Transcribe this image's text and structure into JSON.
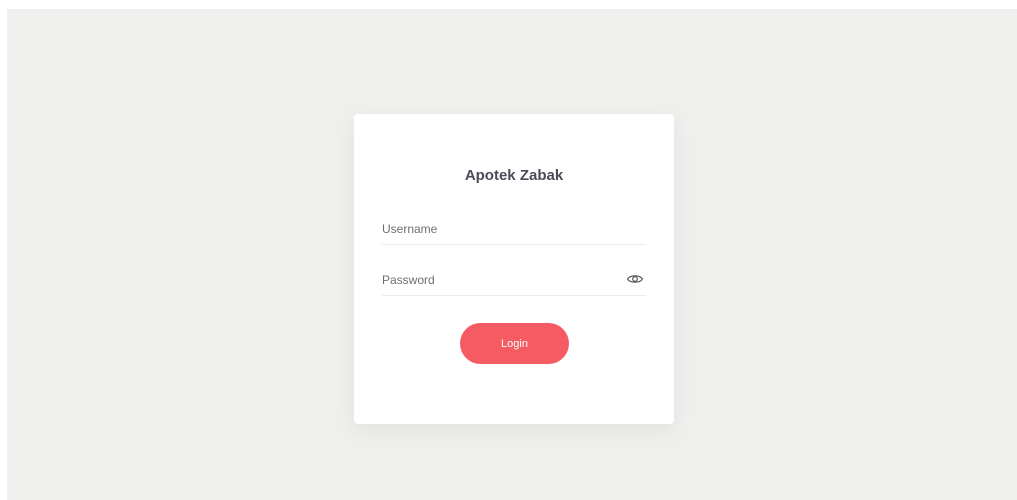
{
  "login_form": {
    "title": "Apotek Zabak",
    "username": {
      "placeholder": "Username",
      "value": ""
    },
    "password": {
      "placeholder": "Password",
      "value": ""
    },
    "password_toggle_icon": "eye-icon",
    "login_label": "Login"
  },
  "colors": {
    "page_background": "#efefed",
    "card_background": "#ffffff",
    "primary_button": "#f45b63",
    "title_text": "#4b4b55"
  }
}
